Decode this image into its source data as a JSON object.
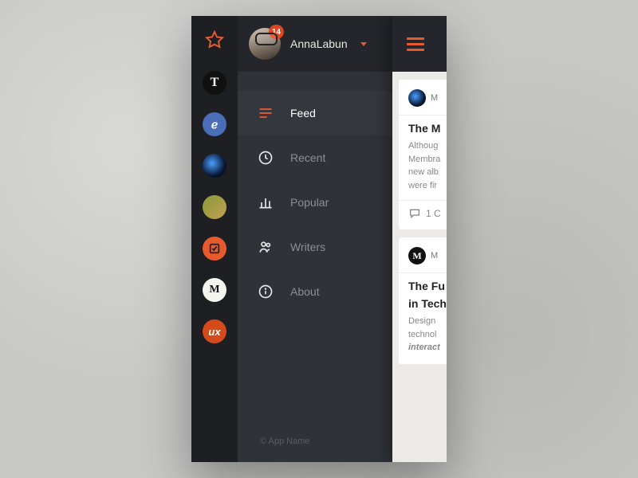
{
  "user": {
    "name": "AnnaLabun",
    "notification_count": "14"
  },
  "rail": {
    "sources": [
      {
        "id": "nyt",
        "glyph": "T"
      },
      {
        "id": "circle-c",
        "glyph": "ℯ"
      },
      {
        "id": "space",
        "glyph": ""
      },
      {
        "id": "bird",
        "glyph": ""
      },
      {
        "id": "orange-sq",
        "glyph": ""
      },
      {
        "id": "medium",
        "glyph": "M"
      },
      {
        "id": "ux",
        "glyph": "ux"
      }
    ]
  },
  "nav": {
    "items": [
      {
        "label": "Feed",
        "icon": "feed",
        "active": true
      },
      {
        "label": "Recent",
        "icon": "clock",
        "active": false
      },
      {
        "label": "Popular",
        "icon": "bars",
        "active": false
      },
      {
        "label": "Writers",
        "icon": "people",
        "active": false
      },
      {
        "label": "About",
        "icon": "info",
        "active": false
      }
    ]
  },
  "footer": {
    "copyright": "© App Name"
  },
  "cards": [
    {
      "source_initial": "M",
      "source_label": "M",
      "title": "The M",
      "body_lines": [
        "Althoug",
        "Membra",
        "new alb",
        "were fir"
      ],
      "comments_label": "1 C"
    },
    {
      "source_initial": "M",
      "source_label": "M",
      "title": "The Fu",
      "title2": "in Tech",
      "body_lines": [
        "Design",
        "technol",
        "interact"
      ]
    }
  ],
  "colors": {
    "accent": "#e65a2e",
    "drawer_bg": "#2f3238",
    "rail_bg": "#1d1f23"
  }
}
